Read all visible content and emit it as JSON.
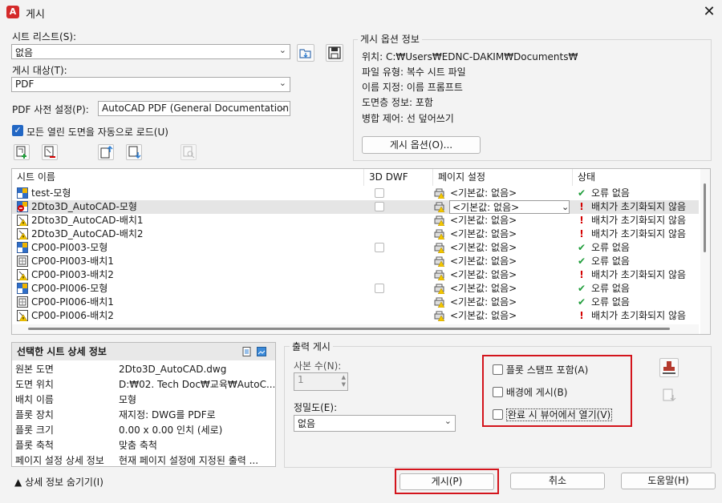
{
  "window": {
    "title": "게시",
    "app_icon_letter": "A"
  },
  "sheet_list": {
    "label": "시트 리스트(S):",
    "value": "없음"
  },
  "publish_to": {
    "label": "게시 대상(T):",
    "value": "PDF"
  },
  "pdf_preset": {
    "label": "PDF 사전 설정(P):",
    "value": "AutoCAD PDF (General Documentation"
  },
  "auto_load": {
    "label": "모든 열린 도면을 자동으로 로드(U)",
    "checked": true
  },
  "publish_options_info": {
    "title": "게시 옵션 정보",
    "location": "위치: C:₩Users₩EDNC-DAKIM₩Documents₩",
    "file_type": "파일 유형: 복수 시트 파일",
    "naming": "이름 지정: 이름 프롬프트",
    "layer_info": "도면층 정보: 포함",
    "merge_control": "병합 제어: 선 덮어쓰기",
    "button": "게시 옵션(O)..."
  },
  "table": {
    "columns": [
      "시트 이름",
      "3D DWF",
      "페이지 설정",
      "상태"
    ],
    "rows": [
      {
        "name": "test-모형",
        "icon": "model-icon",
        "has3d": true,
        "setup": "<기본값: 없음>",
        "status_icon": "ok",
        "status": "오류 없음"
      },
      {
        "name": "2Dto3D_AutoCAD-모형",
        "icon": "model-error-icon",
        "has3d": true,
        "setup": "<기본값: 없음>",
        "status_icon": "warn",
        "status": "배치가 초기화되지 않음",
        "selected": true
      },
      {
        "name": "2Dto3D_AutoCAD-배치1",
        "icon": "layout-warn-icon",
        "has3d": false,
        "setup": "<기본값: 없음>",
        "status_icon": "warn",
        "status": "배치가 초기화되지 않음"
      },
      {
        "name": "2Dto3D_AutoCAD-배치2",
        "icon": "layout-warn-icon",
        "has3d": false,
        "setup": "<기본값: 없음>",
        "status_icon": "warn",
        "status": "배치가 초기화되지 않음"
      },
      {
        "name": "CP00-PI003-모형",
        "icon": "model-icon",
        "has3d": true,
        "setup": "<기본값: 없음>",
        "status_icon": "ok",
        "status": "오류 없음"
      },
      {
        "name": "CP00-PI003-배치1",
        "icon": "layout-icon",
        "has3d": false,
        "setup": "<기본값: 없음>",
        "status_icon": "ok",
        "status": "오류 없음"
      },
      {
        "name": "CP00-PI003-배치2",
        "icon": "layout-warn-icon",
        "has3d": false,
        "setup": "<기본값: 없음>",
        "status_icon": "warn",
        "status": "배치가 초기화되지 않음"
      },
      {
        "name": "CP00-PI006-모형",
        "icon": "model-icon",
        "has3d": true,
        "setup": "<기본값: 없음>",
        "status_icon": "ok",
        "status": "오류 없음"
      },
      {
        "name": "CP00-PI006-배치1",
        "icon": "layout-icon",
        "has3d": false,
        "setup": "<기본값: 없음>",
        "status_icon": "ok",
        "status": "오류 없음"
      },
      {
        "name": "CP00-PI006-배치2",
        "icon": "layout-warn-icon",
        "has3d": false,
        "setup": "<기본값: 없음>",
        "status_icon": "warn",
        "status": "배치가 초기화되지 않음"
      }
    ]
  },
  "details": {
    "title": "선택한 시트 상세 정보",
    "rows": [
      {
        "k": "원본 도면",
        "v": "2Dto3D_AutoCAD.dwg"
      },
      {
        "k": "도면 위치",
        "v": "D:₩02. Tech Doc₩교육₩AutoC..."
      },
      {
        "k": "배치 이름",
        "v": "모형"
      },
      {
        "k": "플롯 장치",
        "v": "재지정: DWG를 PDF로"
      },
      {
        "k": "플롯 크기",
        "v": "0.00 x 0.00 인치 (세로)"
      },
      {
        "k": "플롯 축척",
        "v": "맞춤 축척"
      },
      {
        "k": "페이지 설정 상세 정보",
        "v": "현재 페이지 설정에 지정된 출력 ..."
      }
    ]
  },
  "output": {
    "title": "출력 게시",
    "copies_label": "사본 수(N):",
    "copies_value": "1",
    "precision_label": "정밀도(E):",
    "precision_value": "없음",
    "opt_stamp": "플롯 스탬프 포함(A)",
    "opt_background": "배경에 게시(B)",
    "opt_open_viewer": "완료 시 뷰어에서 열기(V)"
  },
  "footer": {
    "hide_details": "상세 정보 숨기기(I)",
    "publish": "게시(P)",
    "cancel": "취소",
    "help": "도움말(H)"
  }
}
